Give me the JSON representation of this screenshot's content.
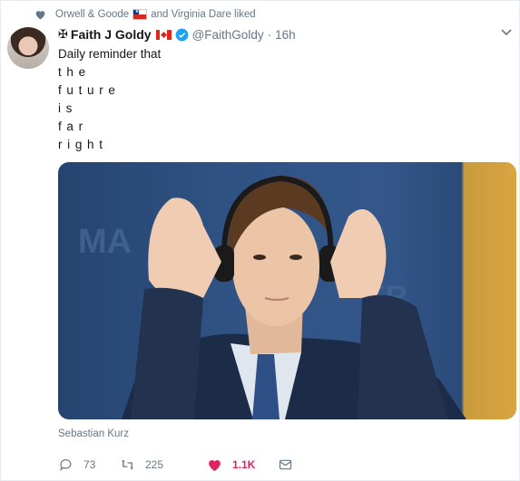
{
  "social_context": {
    "liker_1": "Orwell & Goode",
    "liker_2": "and Virginia Dare liked"
  },
  "author": {
    "name_prefix": "✠",
    "name": "Faith J Goldy",
    "handle": "@FaithGoldy",
    "separator": "·",
    "timestamp": "16h"
  },
  "tweet": {
    "line_1": "Daily reminder that",
    "line_2": "the",
    "line_3": "future",
    "line_4": "is",
    "line_5": "far",
    "line_6": "right"
  },
  "media": {
    "description_icon": "photo"
  },
  "caption": "Sebastian Kurz",
  "actions": {
    "reply_count": "73",
    "retweet_count": "225",
    "like_count": "1.1K"
  },
  "colors": {
    "like_accent": "#e0245e",
    "verified": "#1da1f2",
    "muted_text": "#657786"
  }
}
